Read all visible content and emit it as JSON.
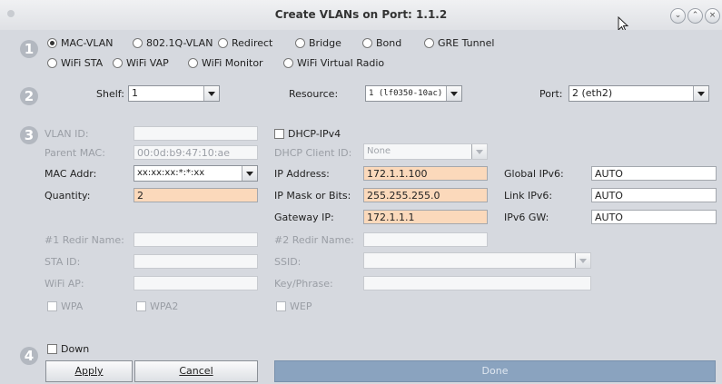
{
  "window": {
    "title": "Create VLANs on Port: 1.1.2"
  },
  "sections": {
    "s1": "1",
    "s2": "2",
    "s3": "3",
    "s4": "4"
  },
  "type_options": [
    {
      "label": "MAC-VLAN",
      "selected": true
    },
    {
      "label": "802.1Q-VLAN",
      "selected": false
    },
    {
      "label": "Redirect",
      "selected": false
    },
    {
      "label": "Bridge",
      "selected": false
    },
    {
      "label": "Bond",
      "selected": false
    },
    {
      "label": "GRE Tunnel",
      "selected": false
    },
    {
      "label": "WiFi STA",
      "selected": false
    },
    {
      "label": "WiFi VAP",
      "selected": false
    },
    {
      "label": "WiFi Monitor",
      "selected": false
    },
    {
      "label": "WiFi Virtual Radio",
      "selected": false
    }
  ],
  "location": {
    "shelf_label": "Shelf:",
    "shelf_value": "1",
    "resource_label": "Resource:",
    "resource_value": "1 (lf0350-10ac)",
    "port_label": "Port:",
    "port_value": "2 (eth2)"
  },
  "form": {
    "vlan_id_label": "VLAN ID:",
    "vlan_id_value": "",
    "parent_mac_label": "Parent MAC:",
    "parent_mac_value": "00:0d:b9:47:10:ae",
    "mac_addr_label": "MAC Addr:",
    "mac_addr_value": "xx:xx:xx:*:*:xx",
    "quantity_label": "Quantity:",
    "quantity_value": "2",
    "dhcp_label": "DHCP-IPv4",
    "dhcp_client_label": "DHCP Client ID:",
    "dhcp_client_value": "None",
    "ip_label": "IP Address:",
    "ip_value": "172.1.1.100",
    "mask_label": "IP Mask or Bits:",
    "mask_value": "255.255.255.0",
    "gw_label": "Gateway IP:",
    "gw_value": "172.1.1.1",
    "global_ipv6_label": "Global IPv6:",
    "global_ipv6_value": "AUTO",
    "link_ipv6_label": "Link IPv6:",
    "link_ipv6_value": "AUTO",
    "ipv6_gw_label": "IPv6 GW:",
    "ipv6_gw_value": "AUTO",
    "redir1_label": "#1 Redir Name:",
    "redir2_label": "#2 Redir Name:",
    "sta_id_label": "STA ID:",
    "ssid_label": "SSID:",
    "wifi_ap_label": "WiFi AP:",
    "key_label": "Key/Phrase:",
    "wpa_label": "WPA",
    "wpa2_label": "WPA2",
    "wep_label": "WEP"
  },
  "footer": {
    "down_label": "Down",
    "apply_label": "Apply",
    "cancel_label": "Cancel",
    "done_label": "Done"
  }
}
